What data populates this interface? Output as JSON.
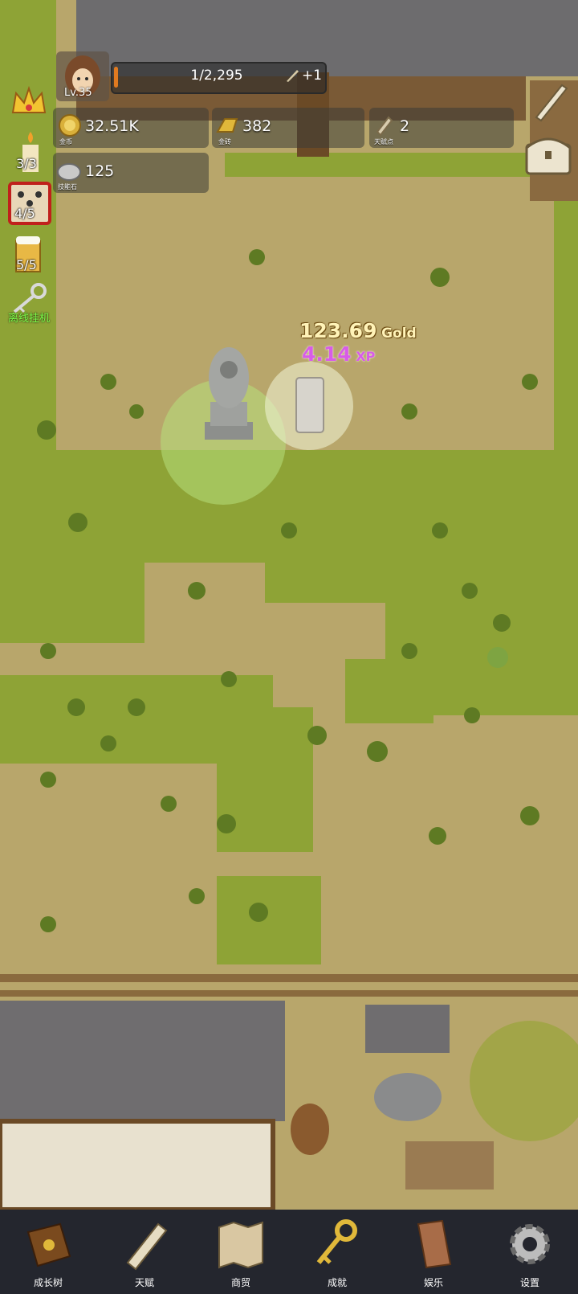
{
  "player": {
    "level": "Lv.35"
  },
  "xp_bar": {
    "text": "1/2,295",
    "bonus": "+1",
    "progress": 0.02
  },
  "resources": {
    "gold": {
      "value": "32.51K",
      "caption": "金币"
    },
    "gold_bar": {
      "value": "382",
      "caption": "金砖"
    },
    "talent_points": {
      "value": "2",
      "caption": "天赋点"
    },
    "skill_stone": {
      "value": "125",
      "caption": "技能石"
    }
  },
  "side_buttons": {
    "candle": "3/3",
    "dice": "4/5",
    "beer": "5/5",
    "afk_label": "离线挂机"
  },
  "floating": {
    "gold_value": "123.69",
    "gold_unit": "Gold",
    "xp_value": "4.14",
    "xp_unit": "XP"
  },
  "nav": [
    {
      "label": "成长树",
      "icon": "book-icon"
    },
    {
      "label": "天赋",
      "icon": "scroll-icon"
    },
    {
      "label": "商贸",
      "icon": "map-icon"
    },
    {
      "label": "成就",
      "icon": "key-icon"
    },
    {
      "label": "娱乐",
      "icon": "parchment-icon"
    },
    {
      "label": "设置",
      "icon": "gear-icon"
    }
  ],
  "colors": {
    "navbar": "#24262e",
    "grass": "#8ea336",
    "dirt": "#b5a36a",
    "xp_text": "#d85ce8",
    "gold_text": "#fff3b8"
  }
}
